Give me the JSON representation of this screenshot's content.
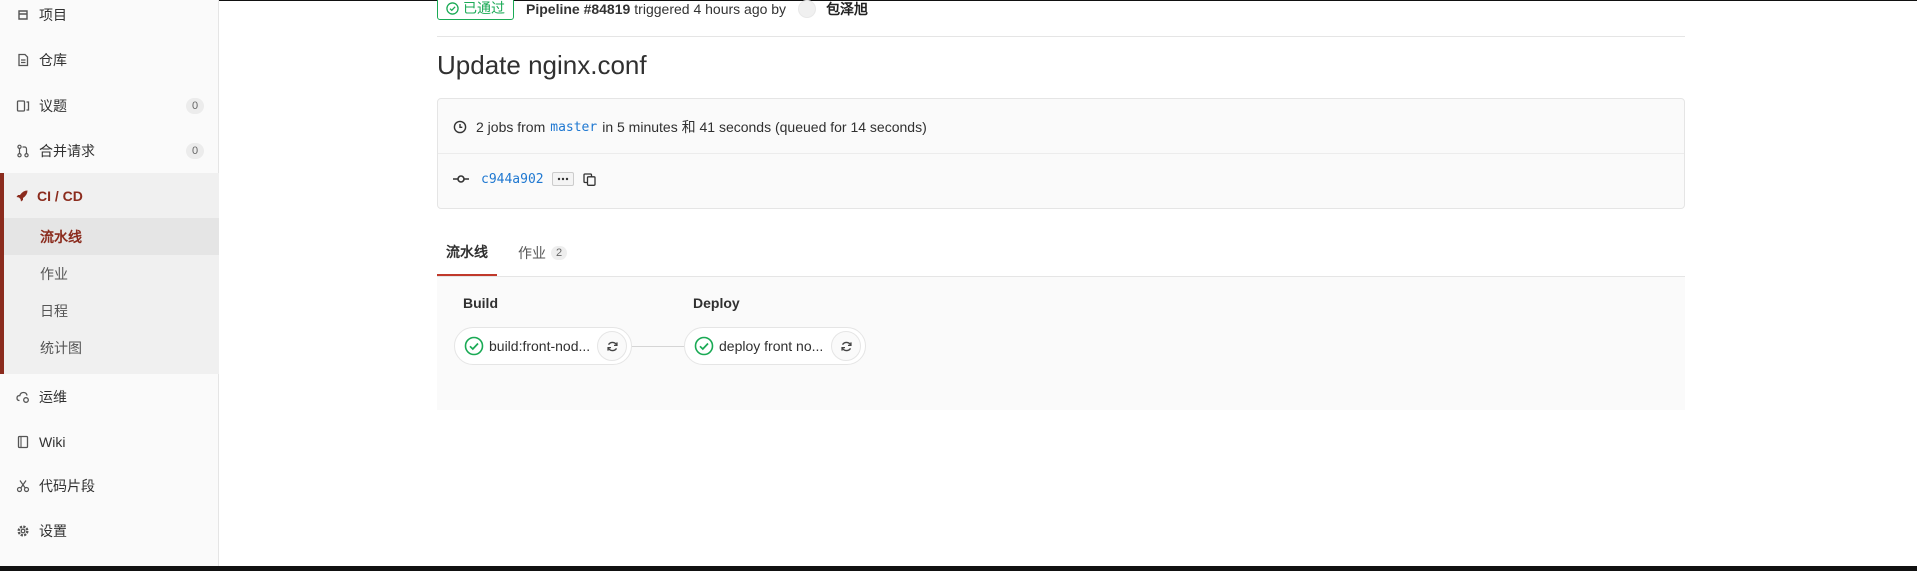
{
  "sidebar": {
    "items": [
      {
        "label": "项目",
        "icon": "project-icon"
      },
      {
        "label": "仓库",
        "icon": "repository-icon"
      },
      {
        "label": "议题",
        "icon": "issues-icon",
        "count": "0"
      },
      {
        "label": "合并请求",
        "icon": "merge-request-icon",
        "count": "0"
      }
    ],
    "cicd": {
      "label": "CI / CD",
      "icon": "rocket-icon",
      "subitems": [
        "流水线",
        "作业",
        "日程",
        "统计图"
      ],
      "active_subitem": "流水线"
    },
    "items_after": [
      {
        "label": "运维",
        "icon": "cloud-gear-icon"
      },
      {
        "label": "Wiki",
        "icon": "book-icon"
      },
      {
        "label": "代码片段",
        "icon": "scissors-icon"
      },
      {
        "label": "设置",
        "icon": "gear-icon"
      }
    ]
  },
  "header": {
    "status": "已通过",
    "pipeline": "Pipeline #84819",
    "triggered_text": "triggered 4 hours ago by",
    "user": "包泽旭"
  },
  "commit_title": "Update nginx.conf",
  "info": {
    "jobs_prefix": "2 jobs from",
    "branch": "master",
    "jobs_suffix": "in 5 minutes 和 41 seconds (queued for 14 seconds)",
    "commit_sha": "c944a902"
  },
  "tabs": [
    {
      "label": "流水线",
      "active": true
    },
    {
      "label": "作业",
      "count": "2",
      "active": false
    }
  ],
  "stages": [
    {
      "name": "Build",
      "job": "build:front-nod...",
      "status": "passed"
    },
    {
      "name": "Deploy",
      "job": "deploy front no...",
      "status": "passed"
    }
  ],
  "colors": {
    "accent": "#8b2b1d",
    "success": "#1aaa55",
    "link": "#1f78d1"
  }
}
